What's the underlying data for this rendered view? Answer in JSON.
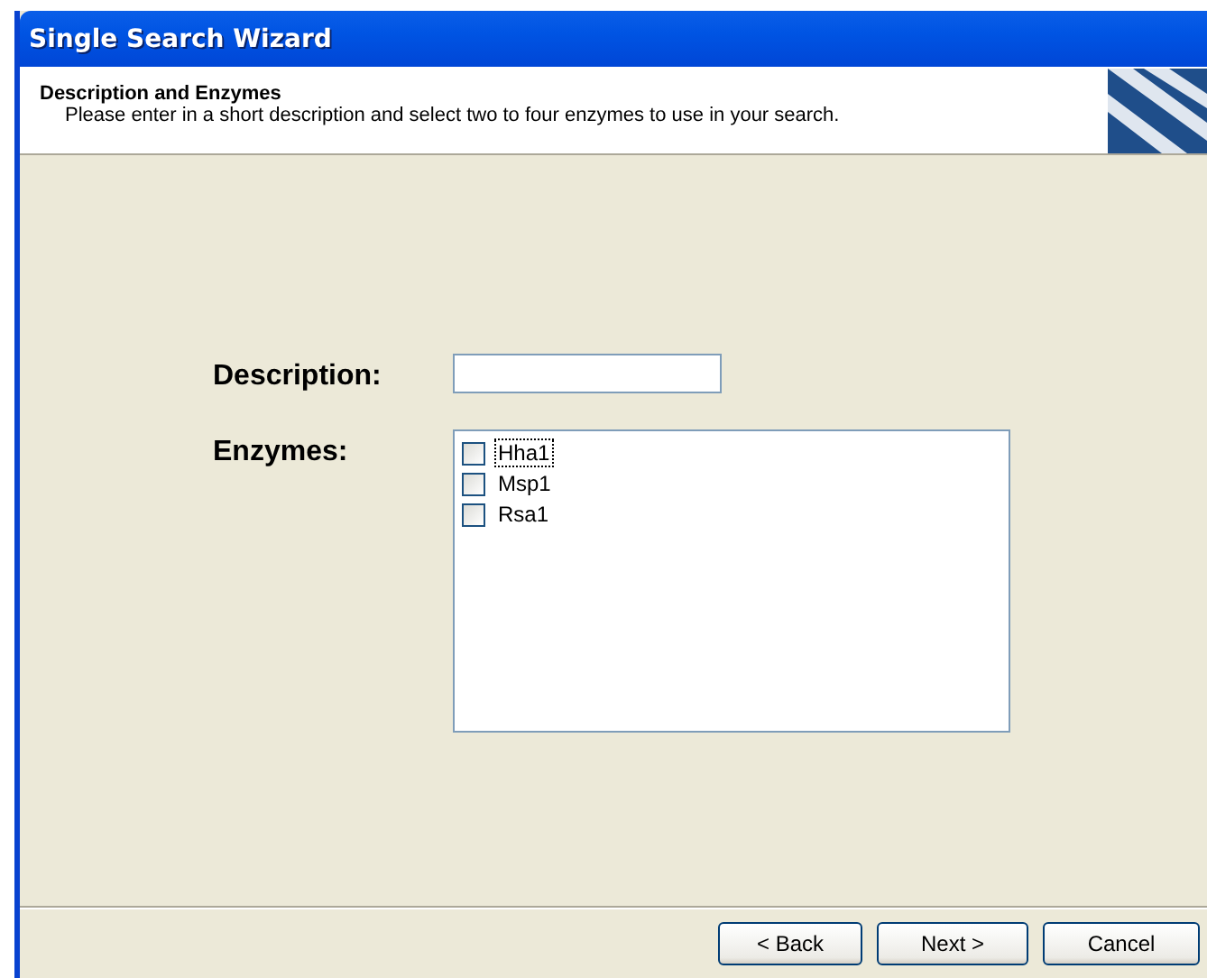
{
  "window": {
    "title": "Single Search Wizard"
  },
  "header": {
    "title": "Description and Enzymes",
    "subtitle": "Please enter in a short description and select two to four enzymes to use in your search."
  },
  "description": {
    "label": "Description:"
  },
  "enzymes": {
    "label": "Enzymes:",
    "items": [
      {
        "name": "Hha1",
        "checked": false,
        "focused": true
      },
      {
        "name": "Msp1",
        "checked": false,
        "focused": false
      },
      {
        "name": "Rsa1",
        "checked": false,
        "focused": false
      }
    ]
  },
  "buttons": [
    {
      "label": "< Back"
    },
    {
      "label": "Next >"
    },
    {
      "label": "Cancel"
    }
  ]
}
